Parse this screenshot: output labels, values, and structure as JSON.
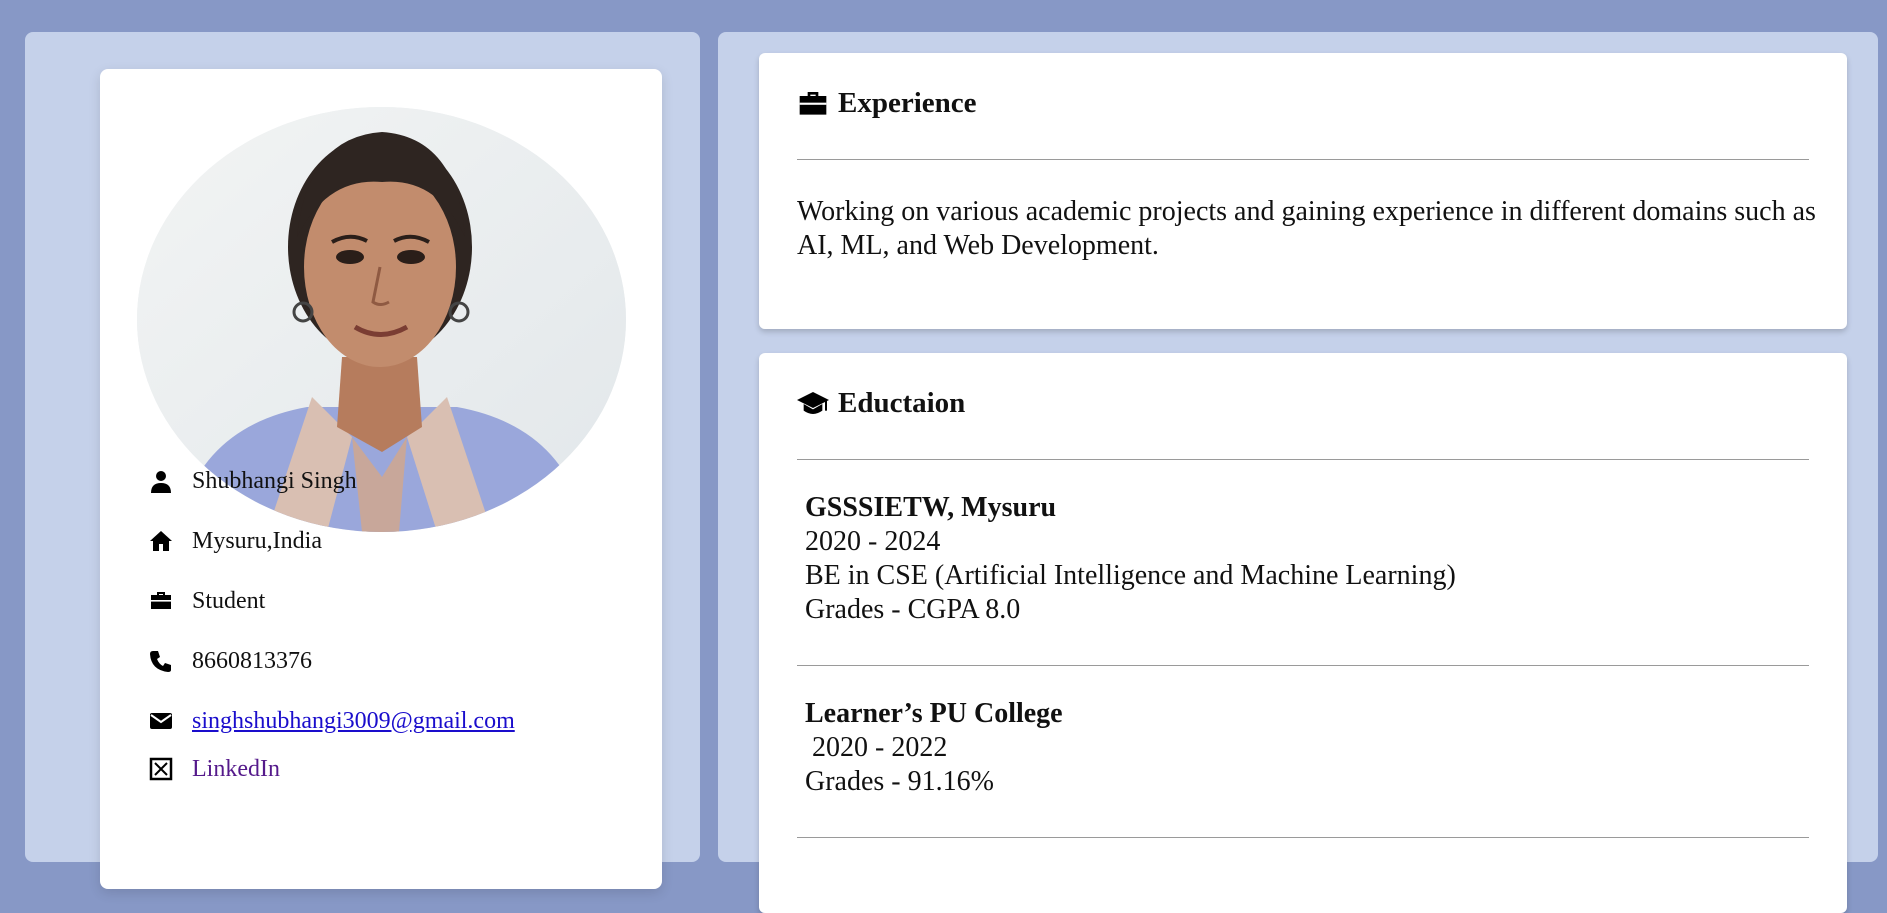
{
  "profile": {
    "name": "Shubhangi Singh",
    "location": "Mysuru,India",
    "occupation": "Student",
    "phone": "8660813376",
    "email": "singhshubhangi3009@gmail.com",
    "linkedin": "LinkedIn"
  },
  "experience": {
    "title": "Experience",
    "description": " Working on various academic projects and gaining experience in different domains such as AI, ML, and Web Development."
  },
  "education": {
    "title": "Eductaion",
    "entries": [
      {
        "institution": "GSSSIETW, Mysuru",
        "years": "2020 - 2024",
        "degree": "BE in CSE (Artificial Intelligence and Machine Learning)",
        "grades": "Grades - CGPA 8.0"
      },
      {
        "institution": "Learner’s PU College",
        "years": " 2020 - 2022",
        "grades": "Grades - 91.16%"
      }
    ]
  },
  "colors": {
    "page_background": "#8798c6",
    "panel_background": "#c5d1ea",
    "card_background": "#ffffff",
    "link": "#1a0dcc",
    "visited_link": "#551a8b"
  },
  "icons": {
    "name": "user-icon",
    "location": "home-icon",
    "occupation": "briefcase-icon",
    "phone": "phone-icon",
    "email": "envelope-icon",
    "linkedin": "linkedin-icon",
    "experience": "briefcase-icon",
    "education": "graduation-cap-icon"
  }
}
